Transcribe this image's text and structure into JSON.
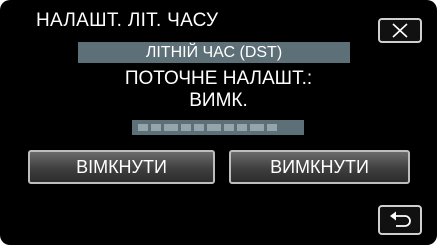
{
  "screen": {
    "title": "НАЛАШТ. ЛІТ. ЧАСУ",
    "banner": "ЛІТНІЙ ЧАС (DST)",
    "current_label": "ПОТОЧНЕ НАЛАШТ.:",
    "current_value": "ВИМК."
  },
  "buttons": {
    "on_label": "ВІМКНУТИ",
    "off_label": "ВИМКНУТИ"
  },
  "icons": {
    "close": "close-icon",
    "back": "back-arrow-icon"
  },
  "colors": {
    "background": "#000000",
    "banner": "#5d6f77",
    "text": "#ffffff"
  }
}
